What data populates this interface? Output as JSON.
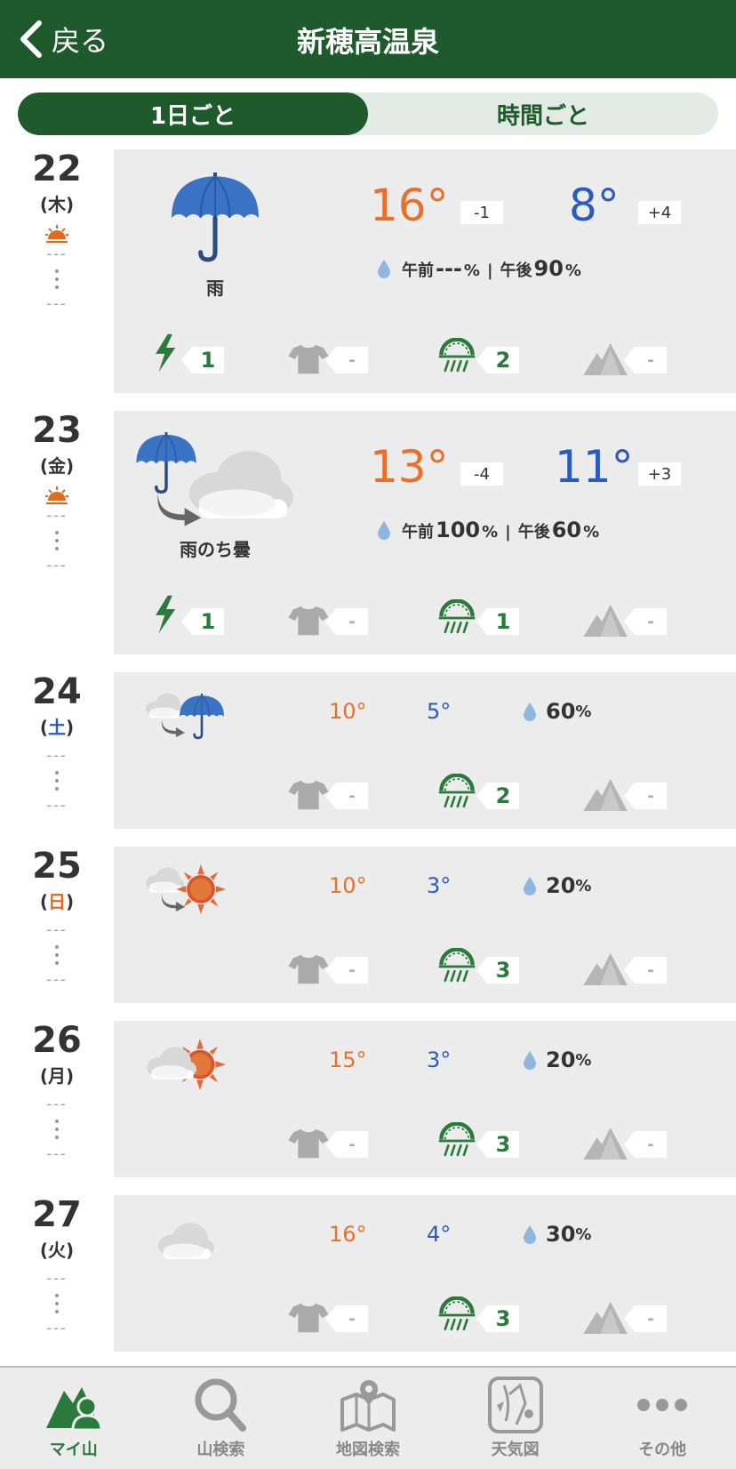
{
  "header": {
    "back_label": "戻る",
    "title": "新穂高温泉"
  },
  "tabs": [
    {
      "label": "1日ごと"
    },
    {
      "label": "時間ごと"
    }
  ],
  "days": [
    {
      "date": "22",
      "weekday_open": "(",
      "weekday": "木",
      "weekday_close": ")",
      "sunrise": "---",
      "sunset": "---",
      "weather": "雨",
      "high": "16°",
      "high_diff": "-1",
      "low": "8°",
      "low_diff": "+4",
      "precip_am_label": "午前",
      "precip_am": "---",
      "precip_pm_label": "午後",
      "precip_pm": "90",
      "pct": "%",
      "sep": "|",
      "thunder": "1",
      "clothing": "-",
      "rain_level": "2",
      "mountain": "-"
    },
    {
      "date": "23",
      "weekday_open": "(",
      "weekday": "金",
      "weekday_close": ")",
      "sunrise": "---",
      "sunset": "---",
      "weather": "雨のち曇",
      "high": "13°",
      "high_diff": "-4",
      "low": "11°",
      "low_diff": "+3",
      "precip_am_label": "午前",
      "precip_am": "100",
      "precip_pm_label": "午後",
      "precip_pm": "60",
      "pct": "%",
      "sep": "|",
      "thunder": "1",
      "clothing": "-",
      "rain_level": "1",
      "mountain": "-"
    },
    {
      "date": "24",
      "weekday_open": "(",
      "weekday": "土",
      "weekday_close": ")",
      "sunrise": "---",
      "sunset": "---",
      "high": "10°",
      "low": "5°",
      "precip": "60",
      "pct": "%",
      "clothing": "-",
      "rain_level": "2",
      "mountain": "-"
    },
    {
      "date": "25",
      "weekday_open": "(",
      "weekday": "日",
      "weekday_close": ")",
      "sunrise": "---",
      "sunset": "---",
      "high": "10°",
      "low": "3°",
      "precip": "20",
      "pct": "%",
      "clothing": "-",
      "rain_level": "3",
      "mountain": "-"
    },
    {
      "date": "26",
      "weekday_open": "(",
      "weekday": "月",
      "weekday_close": ")",
      "sunrise": "---",
      "sunset": "---",
      "high": "15°",
      "low": "3°",
      "precip": "20",
      "pct": "%",
      "clothing": "-",
      "rain_level": "3",
      "mountain": "-"
    },
    {
      "date": "27",
      "weekday_open": "(",
      "weekday": "火",
      "weekday_close": ")",
      "sunrise": "---",
      "sunset": "---",
      "high": "16°",
      "low": "4°",
      "precip": "30",
      "pct": "%",
      "clothing": "-",
      "rain_level": "3",
      "mountain": "-"
    }
  ],
  "nav": [
    {
      "label": "マイ山",
      "icon": "my-mountain-icon"
    },
    {
      "label": "山検索",
      "icon": "search-icon"
    },
    {
      "label": "地図検索",
      "icon": "map-icon"
    },
    {
      "label": "天気図",
      "icon": "weather-map-icon"
    },
    {
      "label": "その他",
      "icon": "more-icon"
    }
  ],
  "colors": {
    "brand_green": "#1f5a2c",
    "high_temp": "#e8702a",
    "low_temp": "#2a5bbf",
    "card_bg": "#ececec"
  }
}
